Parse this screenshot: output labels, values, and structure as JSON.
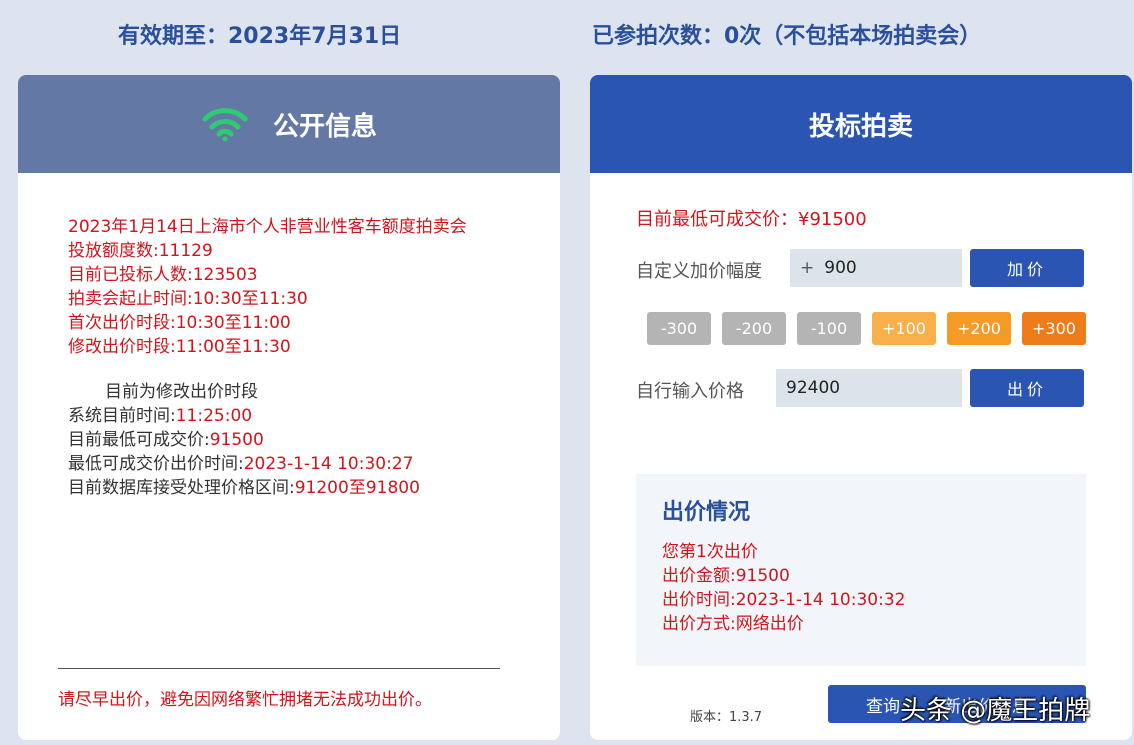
{
  "header": {
    "validity": "有效期至：2023年7月31日",
    "bid_count": "已参拍次数：0次（不包括本场拍卖会）"
  },
  "public_info": {
    "title": "公开信息",
    "auction_name": "2023年1月14日上海市个人非营业性客车额度拍卖会",
    "quota": "投放额度数:11129",
    "bidders": "目前已投标人数:123503",
    "auction_time": "拍卖会起止时间:10:30至11:30",
    "first_bid_period": "首次出价时段:10:30至11:00",
    "modify_bid_period": "修改出价时段:11:00至11:30",
    "current_phase": "目前为修改出价时段",
    "system_time_label": "系统目前时间:",
    "system_time_value": "11:25:00",
    "lowest_price_label": "目前最低可成交价:",
    "lowest_price_value": "91500",
    "lowest_price_time_label": "最低可成交价出价时间:",
    "lowest_price_time_value": "2023-1-14 10:30:27",
    "db_range_label": "目前数据库接受处理价格区间:",
    "db_range_value": "91200至91800",
    "warning": "请尽早出价，避免因网络繁忙拥堵无法成功出价。"
  },
  "bidding": {
    "title": "投标拍卖",
    "lowest_price": "目前最低可成交价：¥91500",
    "custom_increase_label": "自定义加价幅度",
    "custom_increase_prefix": "+",
    "custom_increase_value": "900",
    "increase_button": "加价",
    "steps": [
      "-300",
      "-200",
      "-100",
      "+100",
      "+200",
      "+300"
    ],
    "input_price_label": "自行输入价格",
    "input_price_value": "92400",
    "bid_button": "出价",
    "status": {
      "title": "出价情况",
      "line1": "您第1次出价",
      "line2": "出价金额:91500",
      "line3": "出价时间:2023-1-14 10:30:32",
      "line4": "出价方式:网络出价"
    },
    "version": "版本：1.3.7",
    "query_button": "查询",
    "query_button_rest": "新出价信息"
  },
  "watermark": "头条 @魔王拍牌",
  "colors": {
    "accent": "#2a55b3",
    "alert": "#d3141b",
    "wifi": "#2ecc71"
  }
}
